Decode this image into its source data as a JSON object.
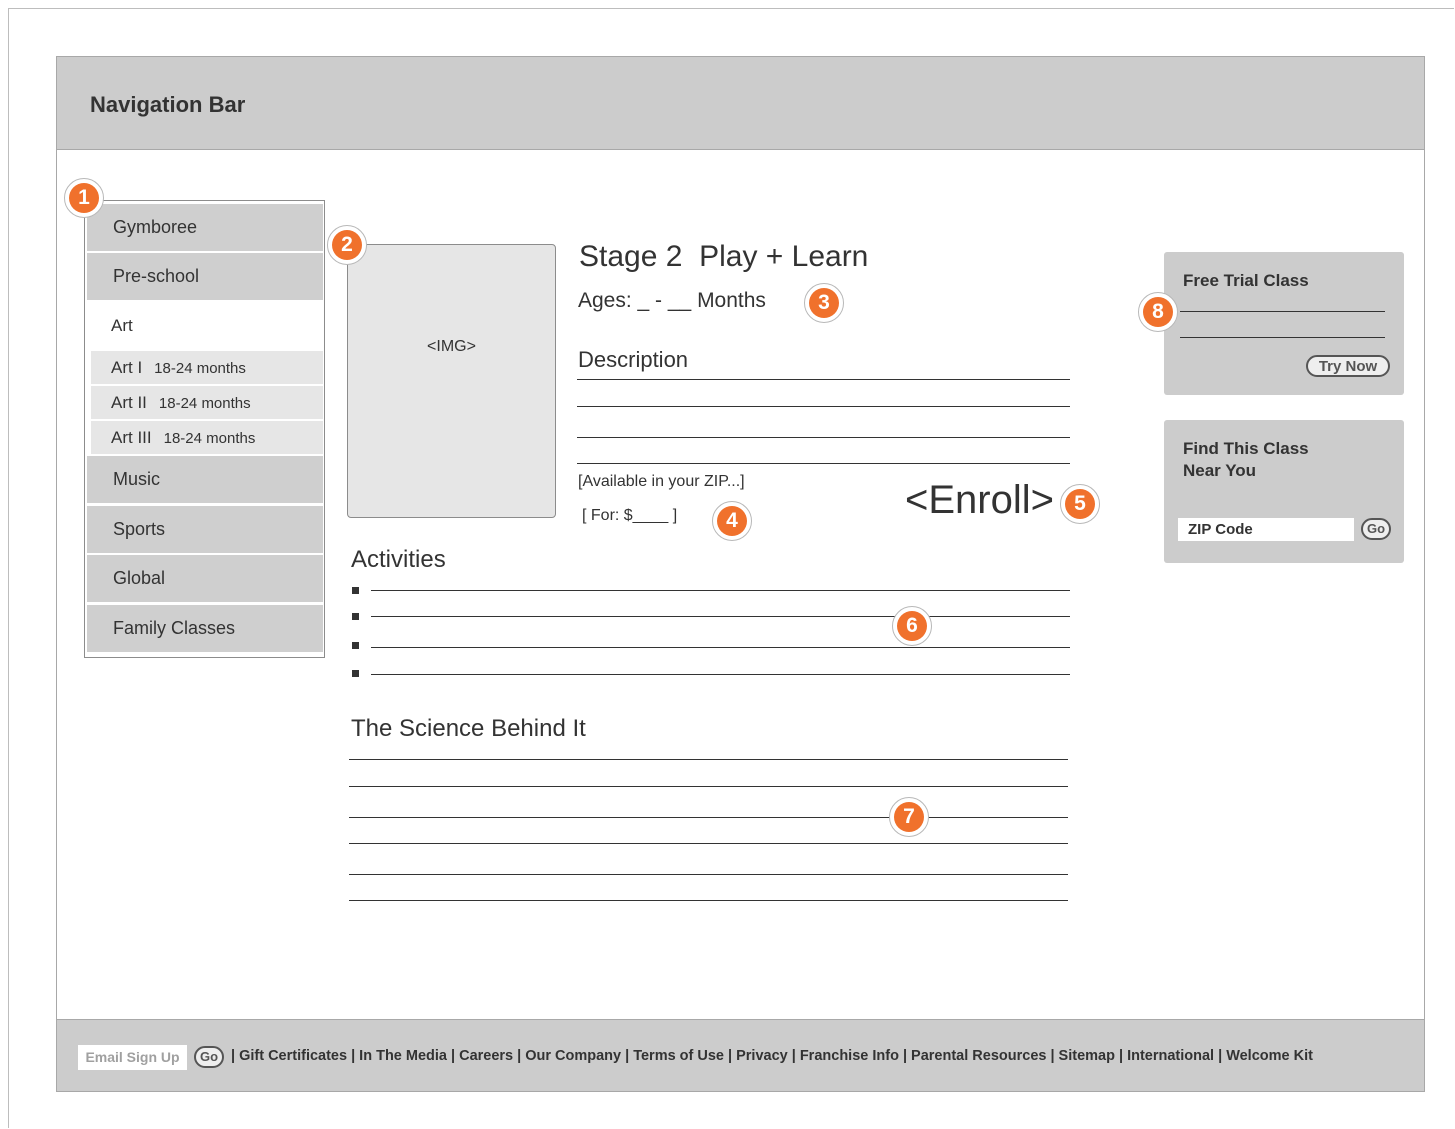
{
  "navbar": {
    "title": "Navigation Bar"
  },
  "sidebar": {
    "items_top": [
      "Gymboree",
      "Pre-school"
    ],
    "art": "Art",
    "sub_items": [
      {
        "name": "Art I",
        "months": "18-24 months"
      },
      {
        "name": "Art II",
        "months": "18-24 months"
      },
      {
        "name": "Art III",
        "months": "18-24 months"
      }
    ],
    "items_bottom": [
      "Music",
      "Sports",
      "Global",
      "Family Classes"
    ]
  },
  "content": {
    "image_placeholder": "<IMG>",
    "title": "Stage 2  Play + Learn",
    "ages": "Ages: _ - __ Months",
    "description_label": "Description",
    "availability": "[Available in your ZIP...]",
    "price": "[ For: $____ ]",
    "enroll": "<Enroll>",
    "activities_label": "Activities",
    "science_label": "The Science Behind It"
  },
  "right_panel": {
    "free_trial_title": "Free Trial Class",
    "try_now": "Try Now",
    "find_class_title_line1": "Find This Class",
    "find_class_title_line2": "Near You",
    "zip_placeholder": "ZIP Code",
    "go": "Go"
  },
  "badges": [
    "1",
    "2",
    "3",
    "4",
    "5",
    "6",
    "7",
    "8"
  ],
  "footer": {
    "email_signup": "Email Sign Up",
    "go": "Go",
    "links": "| Gift Certificates | In The Media | Careers | Our Company | Terms of Use | Privacy | Franchise Info | Parental Resources | Sitemap | International | Welcome Kit"
  },
  "colors": {
    "accent": "#f0712c",
    "panel_gray": "#cccccc"
  }
}
